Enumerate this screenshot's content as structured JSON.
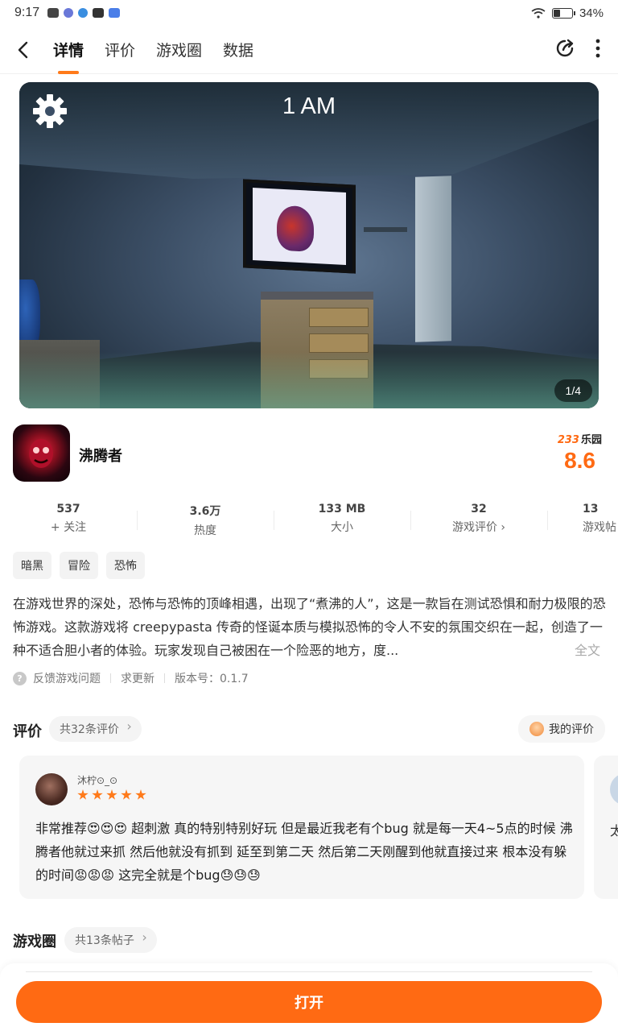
{
  "status_bar": {
    "time": "9:17",
    "battery": "34%",
    "battery_level": 0.34
  },
  "tabs": [
    "详情",
    "评价",
    "游戏圈",
    "数据"
  ],
  "hero": {
    "overlay_time": "1 AM",
    "counter": "1/4"
  },
  "game": {
    "name": "沸腾者",
    "score_brand_num": "233",
    "score_brand_text": "乐园",
    "score": "8.6"
  },
  "stats": [
    {
      "value": "537",
      "label": "+ 关注"
    },
    {
      "value": "3.6万",
      "label": "热度"
    },
    {
      "value": "133 MB",
      "label": "大小"
    },
    {
      "value": "32",
      "label": "游戏评价 ›"
    },
    {
      "value": "13",
      "label": "游戏帖"
    }
  ],
  "tags": [
    "暗黑",
    "冒险",
    "恐怖"
  ],
  "description": {
    "text": "在游戏世界的深处，恐怖与恐怖的顶峰相遇，出现了“煮沸的人”，这是一款旨在测试恐惧和耐力极限的恐怖游戏。这款游戏将 creepypasta 传奇的怪诞本质与模拟恐怖的令人不安的氛围交织在一起，创造了一种不适合胆小者的体验。玩家发现自己被困在一个险恶的地方，度...",
    "more": "全文"
  },
  "meta": {
    "feedback": "反馈游戏问题",
    "request_update": "求更新",
    "version": "版本号：0.1.7",
    "help_icon": "?"
  },
  "reviews": {
    "title": "评价",
    "count_label": "共32条评价",
    "my_review": "我的评价",
    "items": [
      {
        "user": "沐柠⊙_⊙",
        "stars": 5,
        "text": "非常推荐😍😍😍 超刺激 真的特别特别好玩 但是最近我老有个bug 就是每一天4~5点的时候 沸腾者他就过来抓 然后他就没有抓到 延至到第二天 然后第二天刚醒到他就直接过来 根本没有躲的时间😡😡😡 这完全就是个bug😓😓😓"
      }
    ],
    "next_preview_char": "太"
  },
  "circle": {
    "title": "游戏圈",
    "count_label": "共13条帖子"
  },
  "open_button": "打开",
  "colors": {
    "accent": "#ff6a13",
    "tab_indicator": "#ff7a1a"
  }
}
